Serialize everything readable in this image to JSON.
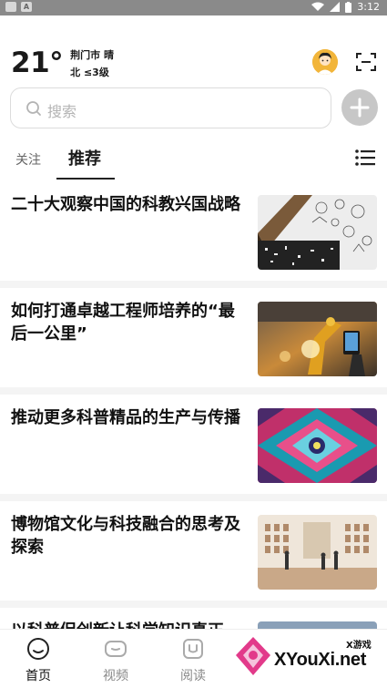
{
  "statusbar": {
    "time": "3:12",
    "left_badge": "A"
  },
  "weather": {
    "temperature": "21°",
    "city_weather": "荆门市 晴",
    "wind": "北 ≤3级"
  },
  "search": {
    "placeholder": "搜索"
  },
  "tabs": {
    "follow": "关注",
    "recommend": "推荐"
  },
  "feed": {
    "items": [
      {
        "title": "二十大观察中国的科教兴国战略",
        "thumb": "sketch-illustration"
      },
      {
        "title": "如何打通卓越工程师培养的“最后一公里”",
        "thumb": "factory-robot"
      },
      {
        "title": "推动更多科普精品的生产与传播",
        "thumb": "kaleidoscope"
      },
      {
        "title": "博物馆文化与科技融合的思考及探索",
        "thumb": "museum-gallery"
      },
      {
        "title": "以科普促创新让科学知识真正",
        "thumb": "partial"
      }
    ]
  },
  "bottom_nav": {
    "home": "首页",
    "video": "视频",
    "read": "阅读"
  },
  "watermark": {
    "brand": "XYouXi.net",
    "tag": "X游戏"
  },
  "colors": {
    "accent_avatar": "#f2b53a",
    "add_button": "#c7c7c7",
    "statusbar": "#8a8a8a"
  }
}
